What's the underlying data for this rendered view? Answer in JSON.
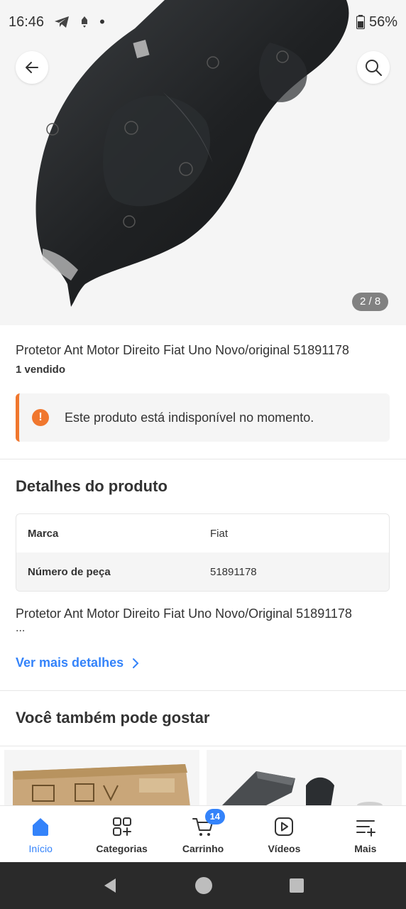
{
  "status_bar": {
    "time": "16:46",
    "battery": "56%"
  },
  "gallery": {
    "counter": "2 / 8"
  },
  "product": {
    "title": "Protetor Ant Motor Direito Fiat Uno Novo/original 51891178",
    "sold": "1 vendido"
  },
  "alert": {
    "icon": "!",
    "text": "Este produto está indisponível no momento.",
    "color": "#f0772e"
  },
  "details": {
    "title": "Detalhes do produto",
    "specs": [
      {
        "key": "Marca",
        "value": "Fiat"
      },
      {
        "key": "Número de peça",
        "value": "51891178"
      }
    ],
    "description": "Protetor Ant Motor Direito Fiat Uno Novo/Original 51891178",
    "ellipsis": "...",
    "more_link": "Ver mais detalhes"
  },
  "recommendations": {
    "title": "Você também pode gostar"
  },
  "bottom_nav": {
    "items": [
      {
        "label": "Início",
        "icon": "home-icon",
        "active": true
      },
      {
        "label": "Categorias",
        "icon": "categories-icon"
      },
      {
        "label": "Carrinho",
        "icon": "cart-icon",
        "badge": "14"
      },
      {
        "label": "Vídeos",
        "icon": "video-play-icon"
      },
      {
        "label": "Mais",
        "icon": "menu-plus-icon"
      }
    ]
  },
  "colors": {
    "accent": "#3483fa",
    "warning": "#f0772e",
    "text": "#333333"
  }
}
